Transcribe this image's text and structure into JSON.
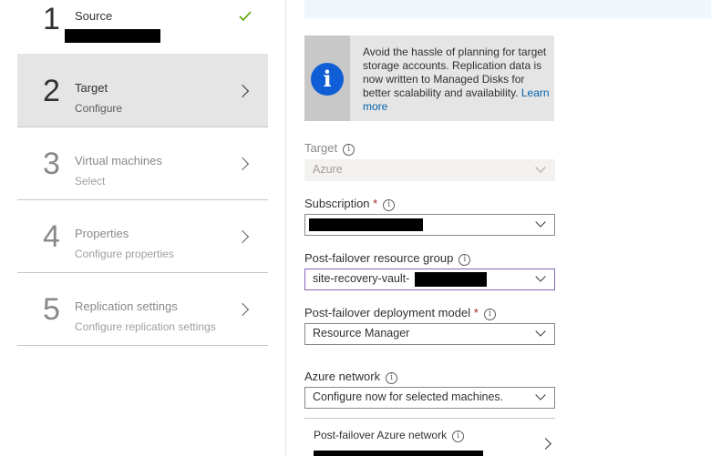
{
  "wizard": {
    "steps": [
      {
        "number": "1",
        "title": "Source",
        "subtitle": ""
      },
      {
        "number": "2",
        "title": "Target",
        "subtitle": "Configure"
      },
      {
        "number": "3",
        "title": "Virtual machines",
        "subtitle": "Select"
      },
      {
        "number": "4",
        "title": "Properties",
        "subtitle": "Configure properties"
      },
      {
        "number": "5",
        "title": "Replication settings",
        "subtitle": "Configure replication settings"
      }
    ]
  },
  "banner": {
    "text": "Avoid the hassle of planning for target storage accounts. Replication data is now written to Managed Disks for better scalability and availability.",
    "link": "Learn more"
  },
  "form": {
    "target_label": "Target",
    "target_value": "Azure",
    "subscription_label": "Subscription",
    "required_mark": "*",
    "resource_group_label": "Post-failover resource group",
    "resource_group_value": "site-recovery-vault-",
    "deployment_model_label": "Post-failover deployment model",
    "deployment_model_value": "Resource Manager",
    "network_label": "Azure network",
    "network_value": "Configure now for selected machines.",
    "post_failover_network_label": "Post-failover Azure network"
  },
  "icons": {
    "check": "checkmark-icon",
    "info": "info-icon",
    "chevron": "chevron-right-icon",
    "dropdown": "chevron-down-icon"
  },
  "colors": {
    "accent": "#0f5ed5",
    "link": "#0062ad",
    "success": "#57a300",
    "required": "#a4262c",
    "focus_border": "#8764b8"
  }
}
